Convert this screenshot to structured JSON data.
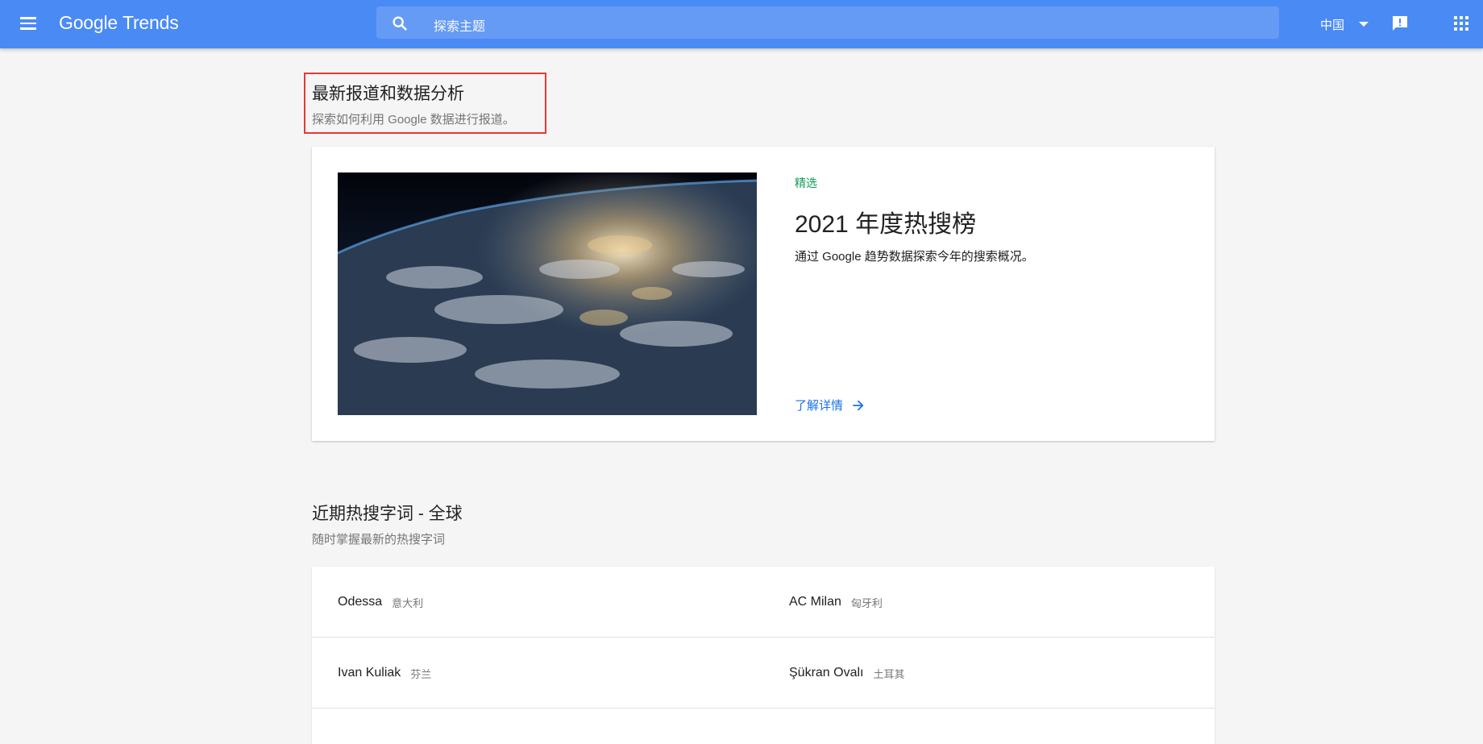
{
  "header": {
    "menu_icon": "hamburger-menu-icon",
    "logo_google": "Google",
    "logo_trends": "Trends",
    "search_placeholder": "探索主题",
    "region": "中国",
    "colors": {
      "header_bg": "#4a8af4"
    }
  },
  "featured_section": {
    "title": "最新报道和数据分析",
    "subtitle": "探索如何利用 Google 数据进行报道。"
  },
  "featured_card": {
    "label": "精选",
    "title": "2021 年度热搜榜",
    "description": "通过 Google 趋势数据探索今年的搜索概况。",
    "link": "了解详情",
    "colors": {
      "label": "#0f9d58",
      "link": "#1a73e8"
    }
  },
  "trending_section": {
    "title": "近期热搜字词 - 全球",
    "subtitle": "随时掌握最新的热搜字词"
  },
  "trending": [
    {
      "term": "Odessa",
      "country": "意大利"
    },
    {
      "term": "AC Milan",
      "country": "匈牙利"
    },
    {
      "term": "Ivan Kuliak",
      "country": "芬兰"
    },
    {
      "term": "Şükran Ovalı",
      "country": "土耳其"
    }
  ]
}
